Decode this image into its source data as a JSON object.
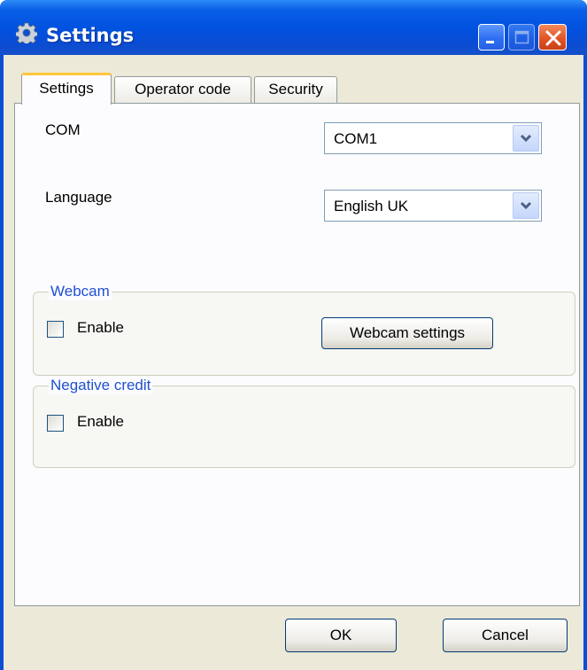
{
  "window": {
    "title": "Settings",
    "icon": "gear-icon"
  },
  "tabs": [
    {
      "label": "Settings",
      "active": true
    },
    {
      "label": "Operator code",
      "active": false
    },
    {
      "label": "Security",
      "active": false
    }
  ],
  "settings": {
    "com_label": "COM",
    "com_value": "COM1",
    "language_label": "Language",
    "language_value": "English UK"
  },
  "webcam": {
    "group_title": "Webcam",
    "enable_label": "Enable",
    "enable_checked": false,
    "settings_button": "Webcam settings"
  },
  "negative_credit": {
    "group_title": "Negative credit",
    "enable_label": "Enable",
    "enable_checked": false
  },
  "footer": {
    "ok_label": "OK",
    "cancel_label": "Cancel"
  },
  "colors": {
    "titlebar": "#0052e0",
    "dialog_bg": "#ece9d8",
    "active_tab_highlight": "#ffc83c",
    "group_title": "#2050d0"
  }
}
